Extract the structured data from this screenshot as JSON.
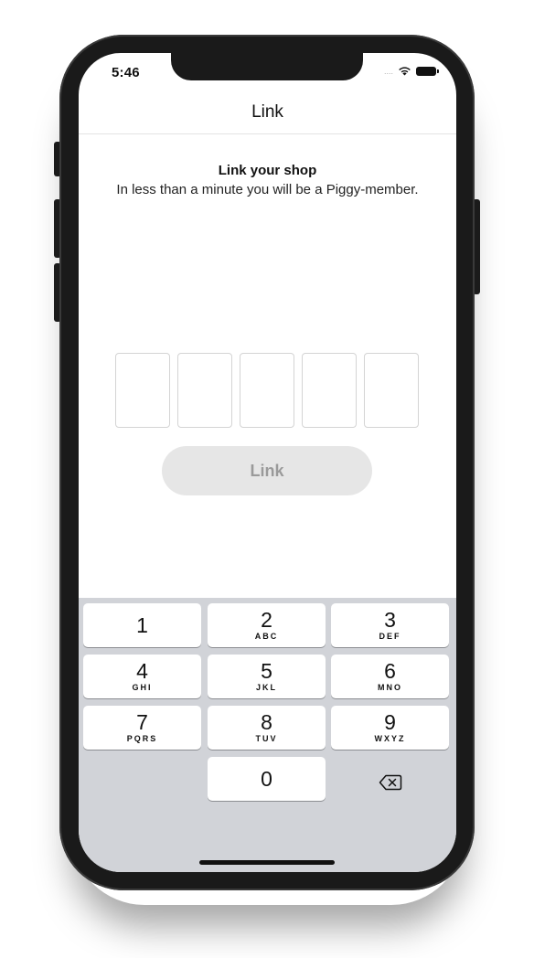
{
  "status_bar": {
    "time": "5:46",
    "signal": "....",
    "wifi_icon": "wifi-icon",
    "battery_icon": "battery-icon"
  },
  "nav": {
    "title": "Link"
  },
  "content": {
    "heading": "Link your shop",
    "subtext": "In less than a minute you will be a Piggy-member.",
    "code_boxes": [
      "",
      "",
      "",
      "",
      ""
    ],
    "link_button": "Link"
  },
  "keypad": {
    "keys": [
      {
        "number": "1",
        "letters": ""
      },
      {
        "number": "2",
        "letters": "ABC"
      },
      {
        "number": "3",
        "letters": "DEF"
      },
      {
        "number": "4",
        "letters": "GHI"
      },
      {
        "number": "5",
        "letters": "JKL"
      },
      {
        "number": "6",
        "letters": "MNO"
      },
      {
        "number": "7",
        "letters": "PQRS"
      },
      {
        "number": "8",
        "letters": "TUV"
      },
      {
        "number": "9",
        "letters": "WXYZ"
      },
      {
        "number": "0",
        "letters": ""
      }
    ],
    "delete_icon": "backspace-icon"
  },
  "colors": {
    "button_bg": "#e6e6e6",
    "button_text": "#9a9a9a",
    "keyboard_bg": "#d1d3d8"
  }
}
